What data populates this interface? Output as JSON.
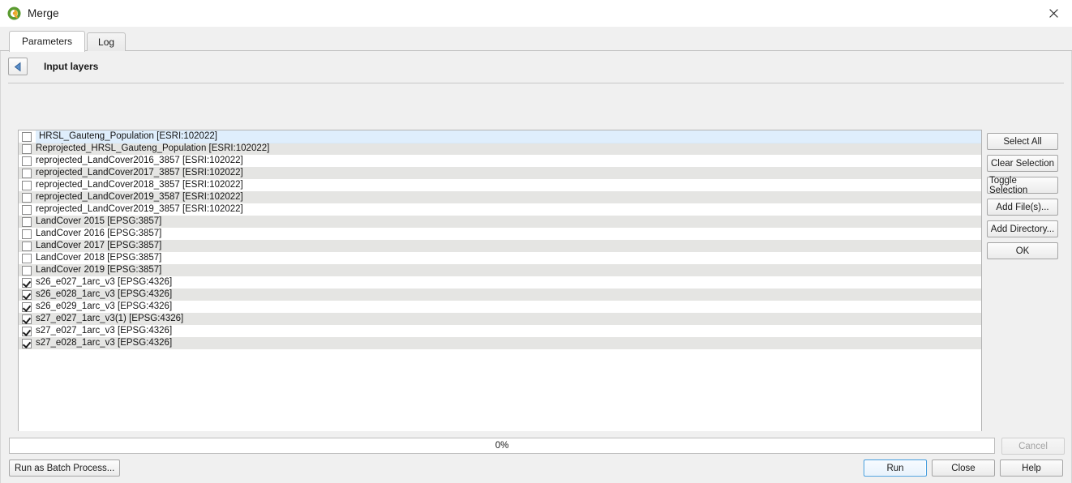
{
  "window": {
    "title": "Merge",
    "app_icon": "qgis-logo-icon",
    "close_icon": "close-icon"
  },
  "tabs": [
    {
      "label": "Parameters",
      "active": true
    },
    {
      "label": "Log",
      "active": false
    }
  ],
  "parameters_page": {
    "back_icon": "back-arrow-icon",
    "section_label": "Input layers",
    "layers": [
      {
        "label": "HRSL_Gauteng_Population [ESRI:102022]",
        "checked": false,
        "selected": true
      },
      {
        "label": "Reprojected_HRSL_Gauteng_Population  [ESRI:102022]",
        "checked": false,
        "selected": false
      },
      {
        "label": "reprojected_LandCover2016_3857 [ESRI:102022]",
        "checked": false,
        "selected": false
      },
      {
        "label": "reprojected_LandCover2017_3857 [ESRI:102022]",
        "checked": false,
        "selected": false
      },
      {
        "label": "reprojected_LandCover2018_3857 [ESRI:102022]",
        "checked": false,
        "selected": false
      },
      {
        "label": "reprojected_LandCover2019_3587 [ESRI:102022]",
        "checked": false,
        "selected": false
      },
      {
        "label": "reprojected_LandCover2019_3857 [ESRI:102022]",
        "checked": false,
        "selected": false
      },
      {
        "label": "LandCover 2015 [EPSG:3857]",
        "checked": false,
        "selected": false
      },
      {
        "label": "LandCover 2016 [EPSG:3857]",
        "checked": false,
        "selected": false
      },
      {
        "label": "LandCover 2017 [EPSG:3857]",
        "checked": false,
        "selected": false
      },
      {
        "label": "LandCover 2018 [EPSG:3857]",
        "checked": false,
        "selected": false
      },
      {
        "label": "LandCover 2019 [EPSG:3857]",
        "checked": false,
        "selected": false
      },
      {
        "label": "s26_e027_1arc_v3 [EPSG:4326]",
        "checked": true,
        "selected": false
      },
      {
        "label": "s26_e028_1arc_v3 [EPSG:4326]",
        "checked": true,
        "selected": false
      },
      {
        "label": "s26_e029_1arc_v3 [EPSG:4326]",
        "checked": true,
        "selected": false
      },
      {
        "label": "s27_e027_1arc_v3(1) [EPSG:4326]",
        "checked": true,
        "selected": false
      },
      {
        "label": "s27_e027_1arc_v3 [EPSG:4326]",
        "checked": true,
        "selected": false
      },
      {
        "label": "s27_e028_1arc_v3 [EPSG:4326]",
        "checked": true,
        "selected": false
      }
    ],
    "side_buttons": [
      {
        "label": "Select All",
        "name": "select-all-button"
      },
      {
        "label": "Clear Selection",
        "name": "clear-selection-button"
      },
      {
        "label": "Toggle Selection",
        "name": "toggle-selection-button"
      },
      {
        "label": "Add File(s)...",
        "name": "add-files-button"
      },
      {
        "label": "Add Directory...",
        "name": "add-directory-button"
      },
      {
        "label": "OK",
        "name": "ok-button"
      }
    ]
  },
  "footer": {
    "progress_text": "0%",
    "progress_value": 0,
    "cancel_label": "Cancel",
    "batch_label": "Run as Batch Process...",
    "run_label": "Run",
    "close_label": "Close",
    "help_label": "Help"
  },
  "colors": {
    "accent": "#3f9ade",
    "selection": "#dfeefc",
    "alt_row": "#e5e5e3",
    "window_bg": "#f0f0f0",
    "qgis_green": "#589632",
    "qgis_orange": "#e9a227"
  }
}
